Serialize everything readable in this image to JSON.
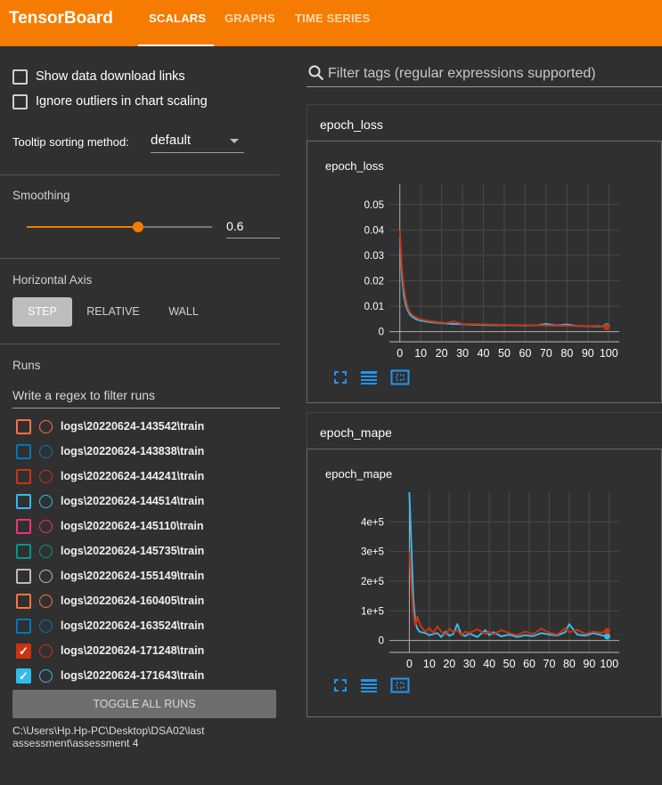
{
  "app": {
    "title": "TensorBoard"
  },
  "tabs": [
    {
      "label": "SCALARS",
      "active": true
    },
    {
      "label": "GRAPHS",
      "active": false
    },
    {
      "label": "TIME SERIES",
      "active": false
    }
  ],
  "sidebar": {
    "show_download_links": {
      "label": "Show data download links",
      "checked": false
    },
    "ignore_outliers": {
      "label": "Ignore outliers in chart scaling",
      "checked": false
    },
    "tooltip_sorting": {
      "label": "Tooltip sorting method:",
      "value": "default"
    },
    "smoothing": {
      "title": "Smoothing",
      "value": "0.6",
      "fraction": 0.6
    },
    "horizontal_axis": {
      "title": "Horizontal Axis",
      "options": [
        "STEP",
        "RELATIVE",
        "WALL"
      ],
      "selected": "STEP"
    },
    "runs": {
      "title": "Runs",
      "filter_placeholder": "Write a regex to filter runs",
      "items": [
        {
          "name": "logs\\20220624-143542\\train",
          "color": "#ff7043",
          "checked": false
        },
        {
          "name": "logs\\20220624-143838\\train",
          "color": "#0077bb",
          "checked": false
        },
        {
          "name": "logs\\20220624-144241\\train",
          "color": "#cc3311",
          "checked": false
        },
        {
          "name": "logs\\20220624-144514\\train",
          "color": "#33bbee",
          "checked": false
        },
        {
          "name": "logs\\20220624-145110\\train",
          "color": "#ee3377",
          "checked": false
        },
        {
          "name": "logs\\20220624-145735\\train",
          "color": "#009988",
          "checked": false
        },
        {
          "name": "logs\\20220624-155149\\train",
          "color": "#bbbbbb",
          "checked": false
        },
        {
          "name": "logs\\20220624-160405\\train",
          "color": "#ff7043",
          "checked": false
        },
        {
          "name": "logs\\20220624-163524\\train",
          "color": "#0077bb",
          "checked": false
        },
        {
          "name": "logs\\20220624-171248\\train",
          "color": "#cc3311",
          "checked": true
        },
        {
          "name": "logs\\20220624-171643\\train",
          "color": "#33bbee",
          "checked": true
        }
      ],
      "toggle_all_label": "TOGGLE ALL RUNS",
      "log_dir": "C:\\Users\\Hp.Hp-PC\\Desktop\\DSA02\\last assessment\\assessment 4"
    }
  },
  "main": {
    "filter_placeholder": "Filter tags (regular expressions supported)",
    "groups": [
      {
        "header": "epoch_loss",
        "card_title": "epoch_loss"
      },
      {
        "header": "epoch_mape",
        "card_title": "epoch_mape"
      }
    ]
  },
  "chart_data": [
    {
      "type": "line",
      "title": "epoch_loss",
      "xlim": [
        -5,
        105
      ],
      "ylim": [
        -0.004,
        0.058
      ],
      "x_ticks": [
        0,
        10,
        20,
        30,
        40,
        50,
        60,
        70,
        80,
        90,
        100
      ],
      "y_ticks": [
        0,
        0.01,
        0.02,
        0.03,
        0.04,
        0.05
      ],
      "y_tick_labels": [
        "0",
        "0.01",
        "0.02",
        "0.03",
        "0.04",
        "0.05"
      ],
      "series": [
        {
          "color": "#33bbee",
          "x": [
            0,
            1,
            2,
            3,
            4,
            5,
            6,
            8,
            10,
            14,
            18,
            22,
            26,
            30,
            36,
            42,
            48,
            54,
            60,
            66,
            70,
            75,
            80,
            85,
            90,
            95,
            99
          ],
          "y": [
            0.037,
            0.022,
            0.014,
            0.01,
            0.008,
            0.0065,
            0.0058,
            0.0048,
            0.0043,
            0.0038,
            0.0035,
            0.0032,
            0.003,
            0.0029,
            0.0027,
            0.0026,
            0.0025,
            0.0025,
            0.0024,
            0.0025,
            0.003,
            0.0024,
            0.0028,
            0.0022,
            0.0021,
            0.0021,
            0.0021
          ]
        },
        {
          "color": "#cc3311",
          "x": [
            0,
            1,
            2,
            3,
            4,
            5,
            6,
            8,
            10,
            14,
            18,
            22,
            26,
            30,
            36,
            42,
            48,
            54,
            60,
            66,
            70,
            75,
            80,
            85,
            90,
            95,
            99
          ],
          "y": [
            0.04,
            0.025,
            0.017,
            0.012,
            0.009,
            0.0075,
            0.0065,
            0.0055,
            0.0048,
            0.0042,
            0.0038,
            0.0034,
            0.004,
            0.003,
            0.0029,
            0.0028,
            0.0027,
            0.0026,
            0.0025,
            0.0025,
            0.0024,
            0.0023,
            0.0023,
            0.0022,
            0.0021,
            0.0023,
            0.0018
          ]
        }
      ]
    },
    {
      "type": "line",
      "title": "epoch_mape",
      "xlim": [
        -10,
        105
      ],
      "ylim": [
        -40000,
        500000
      ],
      "x_ticks": [
        0,
        10,
        20,
        30,
        40,
        50,
        60,
        70,
        80,
        90,
        100
      ],
      "y_ticks": [
        0,
        100000,
        200000,
        300000,
        400000
      ],
      "y_tick_labels": [
        "0",
        "1e+5",
        "2e+5",
        "3e+5",
        "4e+5"
      ],
      "series": [
        {
          "color": "#33bbee",
          "x": [
            0,
            1,
            2,
            3,
            4,
            5,
            6,
            8,
            10,
            12,
            14,
            16,
            18,
            20,
            22,
            24,
            26,
            28,
            30,
            34,
            38,
            40,
            42,
            46,
            50,
            54,
            58,
            62,
            66,
            70,
            74,
            78,
            80,
            84,
            88,
            92,
            96,
            99
          ],
          "y": [
            500000,
            320000,
            140000,
            60000,
            40000,
            30000,
            28000,
            25000,
            18000,
            22000,
            25000,
            12000,
            30000,
            16000,
            22000,
            55000,
            20000,
            15000,
            24000,
            12000,
            35000,
            18000,
            28000,
            14000,
            20000,
            12000,
            18000,
            15000,
            25000,
            20000,
            17000,
            28000,
            55000,
            20000,
            16000,
            25000,
            18000,
            14000
          ]
        },
        {
          "color": "#cc3311",
          "x": [
            0,
            1,
            2,
            3,
            4,
            5,
            6,
            8,
            10,
            12,
            14,
            16,
            18,
            20,
            22,
            24,
            26,
            28,
            30,
            34,
            38,
            40,
            42,
            46,
            50,
            54,
            58,
            62,
            66,
            70,
            74,
            78,
            80,
            84,
            88,
            92,
            96,
            99
          ],
          "y": [
            300000,
            180000,
            90000,
            50000,
            80000,
            60000,
            45000,
            30000,
            42000,
            25000,
            48000,
            30000,
            20000,
            40000,
            28000,
            35000,
            18000,
            30000,
            25000,
            38000,
            22000,
            30000,
            20000,
            35000,
            25000,
            18000,
            30000,
            22000,
            40000,
            26000,
            20000,
            42000,
            28000,
            36000,
            22000,
            30000,
            26000,
            32000
          ]
        }
      ]
    }
  ]
}
